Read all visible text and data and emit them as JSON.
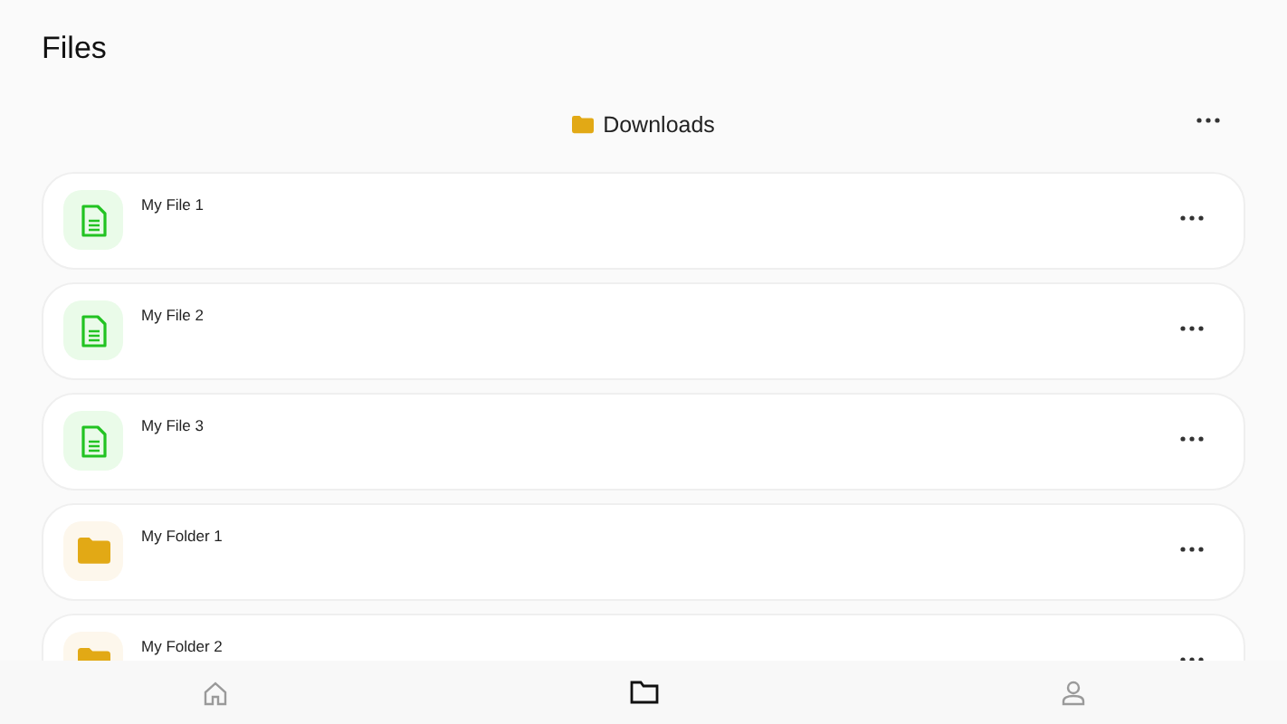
{
  "header": {
    "title": "Files"
  },
  "path_bar": {
    "folder": "Downloads"
  },
  "items": [
    {
      "kind": "file",
      "name": "My File 1"
    },
    {
      "kind": "file",
      "name": "My File 2"
    },
    {
      "kind": "file",
      "name": "My File 3"
    },
    {
      "kind": "folder",
      "name": "My Folder 1"
    },
    {
      "kind": "folder",
      "name": "My Folder 2"
    }
  ],
  "nav": [
    {
      "kind": "home",
      "selected": false
    },
    {
      "kind": "files",
      "selected": true
    },
    {
      "kind": "profile",
      "selected": false
    }
  ]
}
